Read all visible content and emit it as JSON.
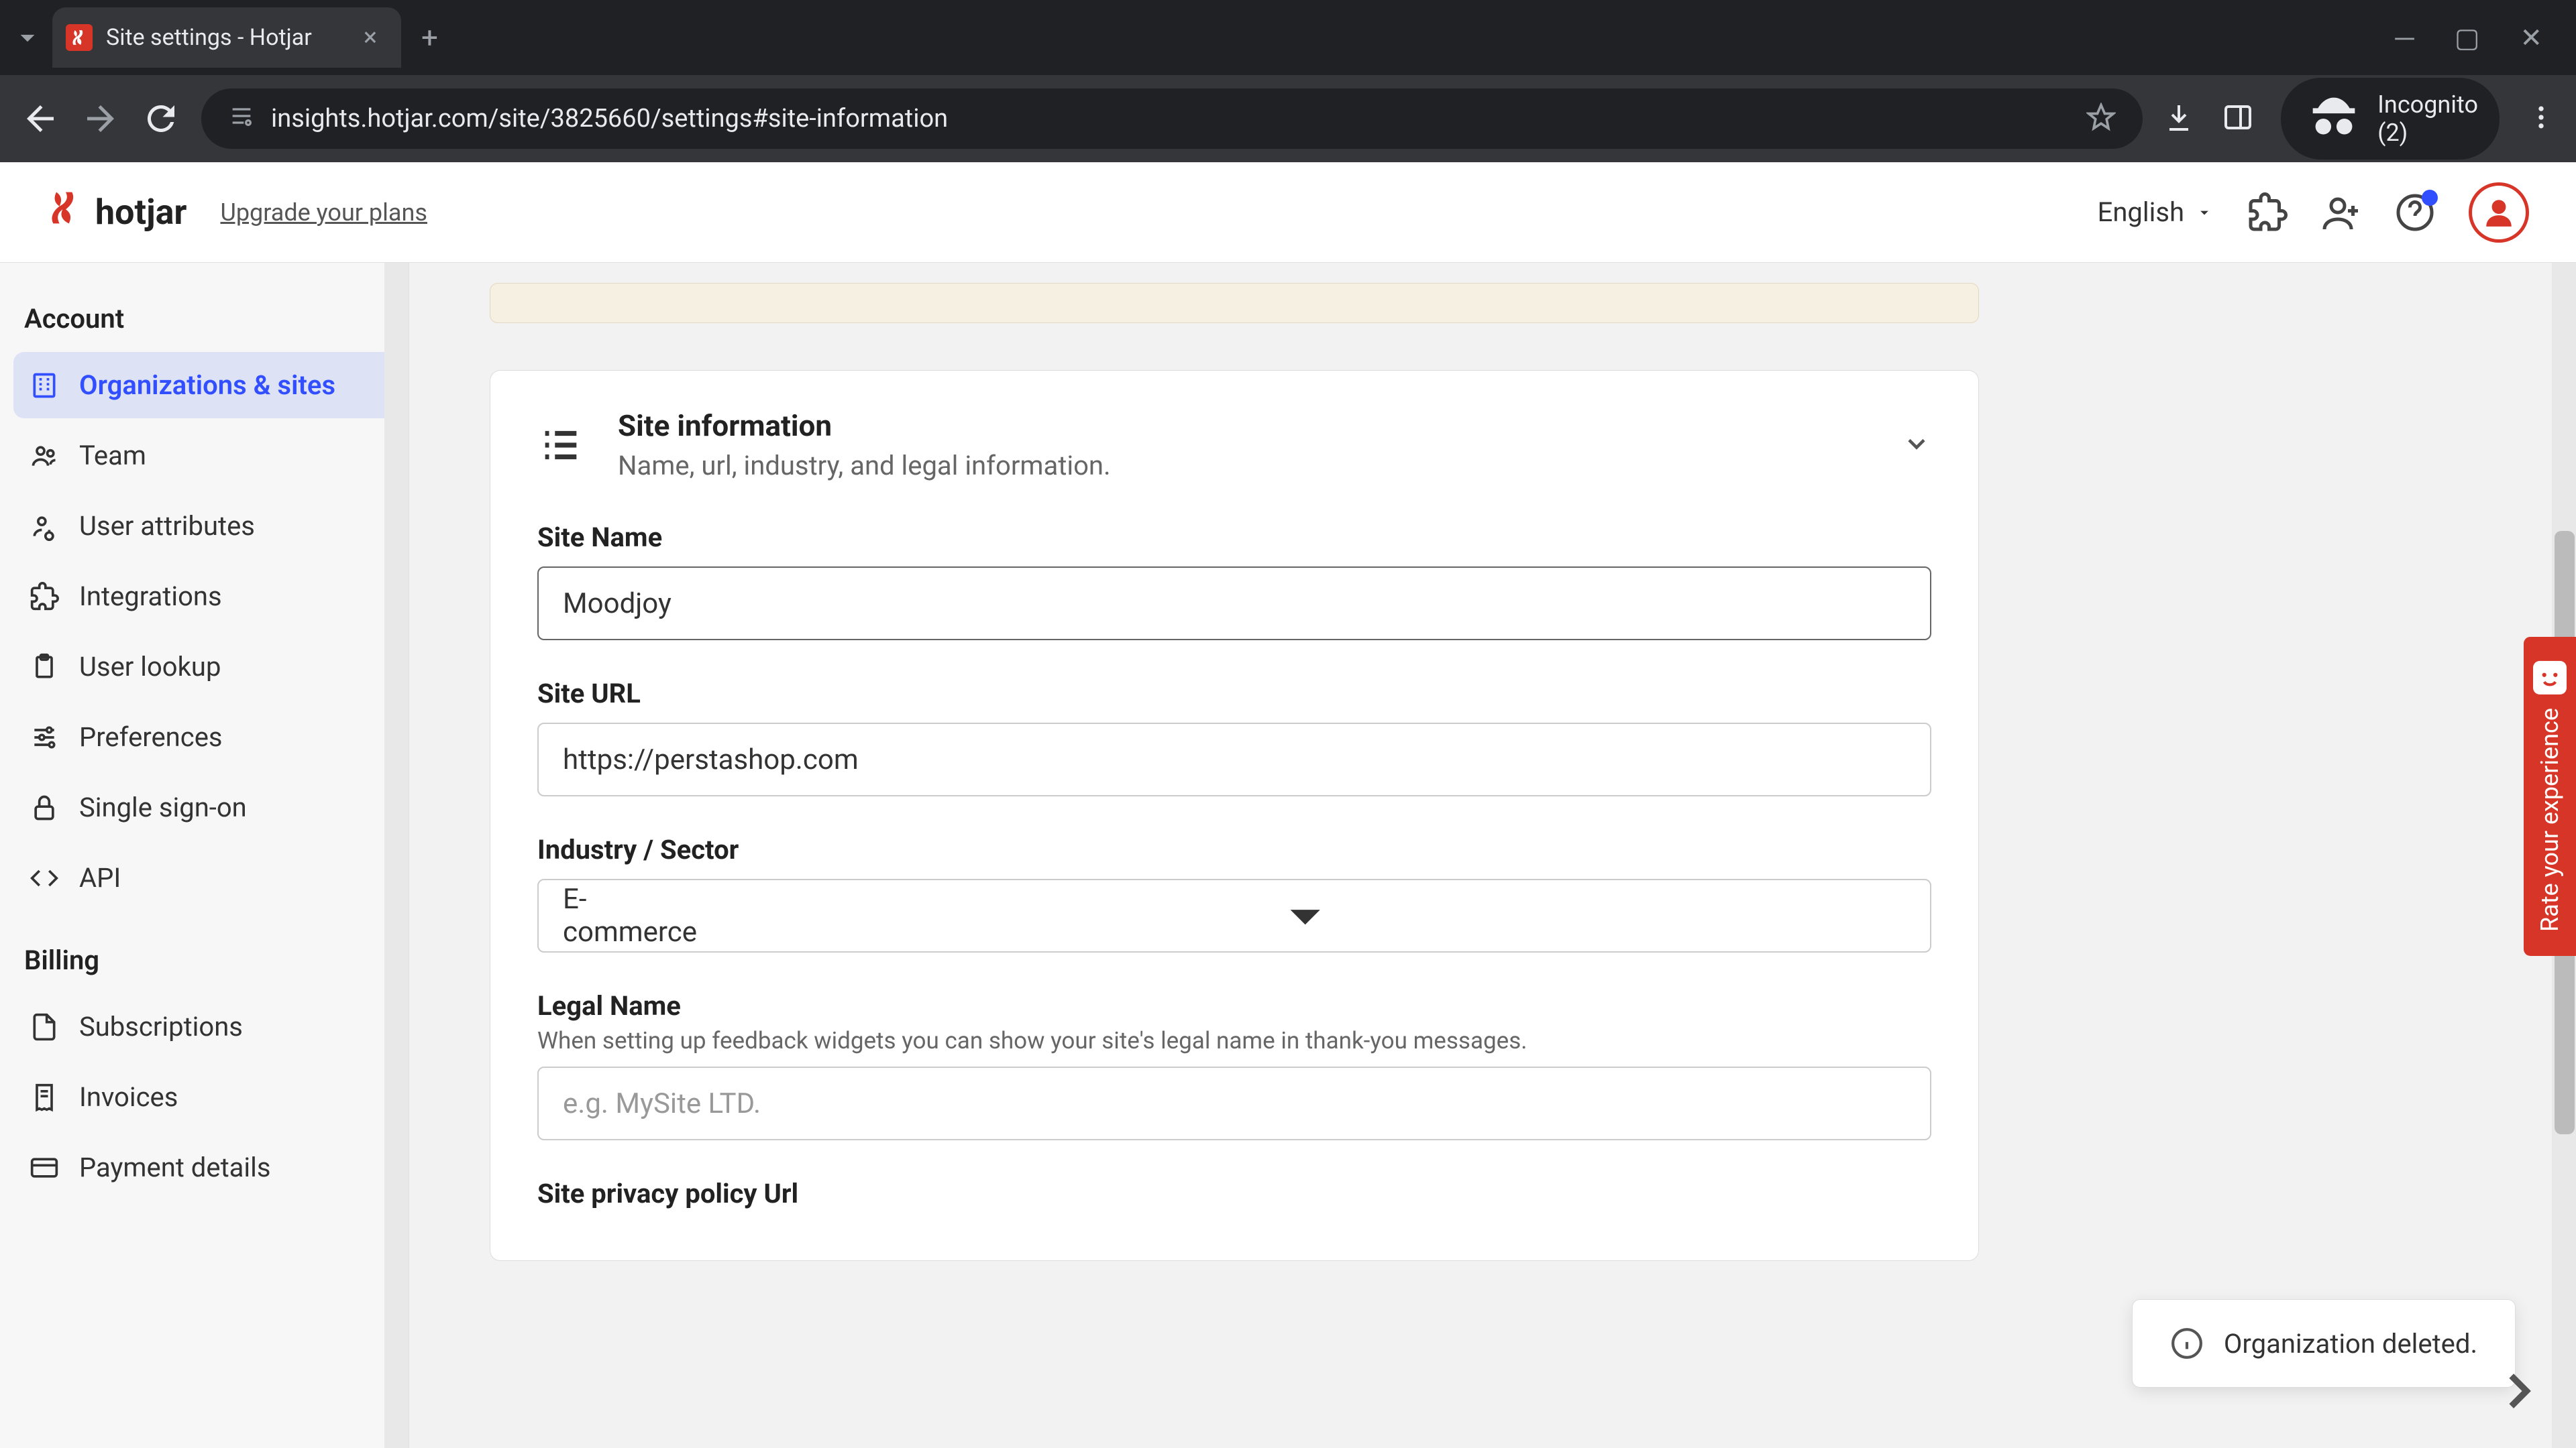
{
  "browser": {
    "tab_title": "Site settings - Hotjar",
    "url": "insights.hotjar.com/site/3825660/settings#site-information",
    "incognito": "Incognito (2)"
  },
  "header": {
    "logo_text": "hotjar",
    "upgrade": "Upgrade your plans",
    "language": "English"
  },
  "sidebar": {
    "account_label": "Account",
    "billing_label": "Billing",
    "items_account": [
      {
        "label": "Organizations & sites",
        "active": true
      },
      {
        "label": "Team"
      },
      {
        "label": "User attributes"
      },
      {
        "label": "Integrations"
      },
      {
        "label": "User lookup"
      },
      {
        "label": "Preferences"
      },
      {
        "label": "Single sign-on"
      },
      {
        "label": "API"
      }
    ],
    "items_billing": [
      {
        "label": "Subscriptions"
      },
      {
        "label": "Invoices"
      },
      {
        "label": "Payment details"
      }
    ]
  },
  "card": {
    "title": "Site information",
    "subtitle": "Name, url, industry, and legal information."
  },
  "form": {
    "site_name_label": "Site Name",
    "site_name_value": "Moodjoy",
    "site_url_label": "Site URL",
    "site_url_value": "https://perstashop.com",
    "industry_label": "Industry / Sector",
    "industry_value": "E-commerce",
    "legal_name_label": "Legal Name",
    "legal_name_help": "When setting up feedback widgets you can show your site's legal name in thank-you messages.",
    "legal_name_placeholder": "e.g. MySite LTD.",
    "privacy_label": "Site privacy policy Url"
  },
  "feedback_tab": "Rate your experience",
  "toast": "Organization deleted."
}
